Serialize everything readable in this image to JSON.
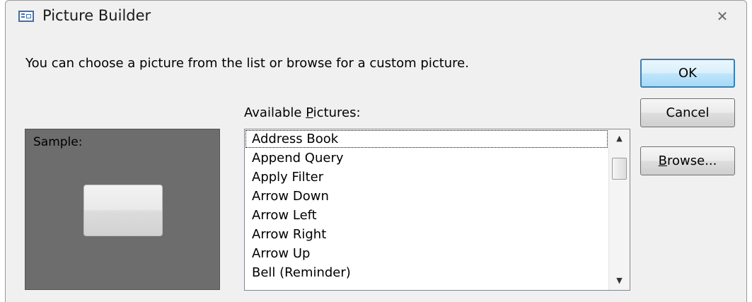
{
  "window": {
    "title": "Picture Builder",
    "close_glyph": "✕"
  },
  "instruction": "You can choose a picture from the list or browse for a custom picture.",
  "sample": {
    "label": "Sample:"
  },
  "available": {
    "label_prefix": "Available ",
    "label_accel": "P",
    "label_rest": "ictures:",
    "items": [
      "Address Book",
      "Append Query",
      "Apply Filter",
      "Arrow Down",
      "Arrow Left",
      "Arrow Right",
      "Arrow Up",
      "Bell (Reminder)"
    ],
    "selected_index": 0
  },
  "scrollbar": {
    "up_glyph": "▲",
    "down_glyph": "▼"
  },
  "buttons": {
    "ok": "OK",
    "cancel": "Cancel",
    "browse_accel": "B",
    "browse_rest": "rowse..."
  },
  "colors": {
    "sample_background": "#6d6d6d",
    "default_button_border": "#3c7fb1"
  }
}
